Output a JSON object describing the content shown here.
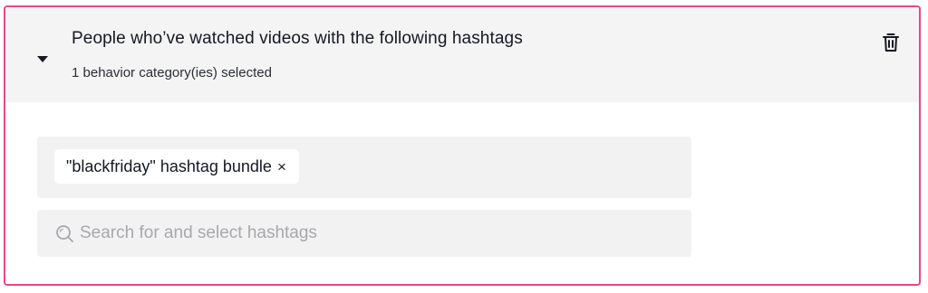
{
  "header": {
    "title": "People who’ve watched videos with the following hashtags",
    "subtitle": "1 behavior category(ies) selected",
    "toggle_icon": "caret-down-icon",
    "delete_icon": "trash-icon"
  },
  "selected_tags": [
    {
      "label": "\"blackfriday\" hashtag bundle",
      "remove_symbol": "×"
    }
  ],
  "search": {
    "value": "",
    "placeholder": "Search for and select hashtags",
    "icon": "search-icon"
  },
  "colors": {
    "accent_border": "#e8478b",
    "header_bg": "#f4f4f5",
    "field_bg": "#f2f2f3",
    "text": "#161823",
    "placeholder": "#a7a8ac"
  }
}
